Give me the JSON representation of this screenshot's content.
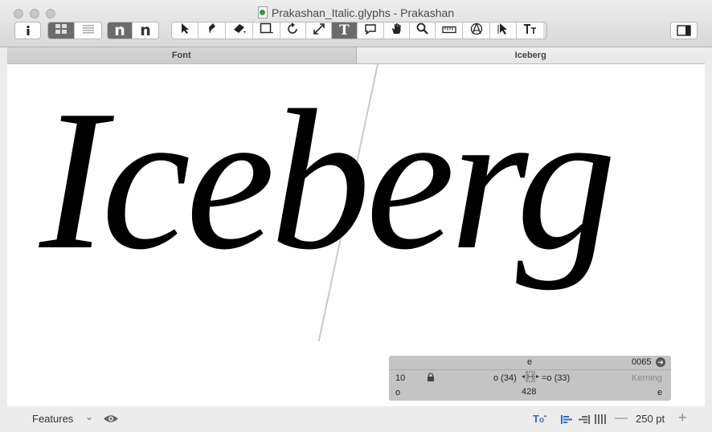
{
  "window": {
    "title": "Prakashan_Italic.glyphs - Prakashan"
  },
  "toolbar": {
    "tools": [
      "info-icon",
      "grid-view-icon",
      "list-view-icon",
      "show-n-icon",
      "show-n-outline-icon",
      "select-icon",
      "pen-icon",
      "eraser-icon",
      "rectangle-icon",
      "rotate-icon",
      "scale-icon",
      "text-icon",
      "annotation-icon",
      "hand-icon",
      "zoom-icon",
      "measure-icon",
      "anchor-icon",
      "select-all-icon",
      "text-scale-icon",
      "sidebar-icon"
    ],
    "active_tool": "text-icon"
  },
  "tabs": [
    {
      "label": "Font",
      "active": true
    },
    {
      "label": "Iceberg",
      "active": false
    }
  ],
  "editor": {
    "text": "Iceberg"
  },
  "glyph_info": {
    "glyph_name": "e",
    "unicode": "0065",
    "lsb": "10",
    "left_group": "o (34)",
    "right_group": "=o (33)",
    "width": "428",
    "kerning_label": "Kerning",
    "left_kern_group": "o",
    "right_kern_group": "e"
  },
  "statusbar": {
    "features_label": "Features",
    "zoom": "250 pt"
  },
  "colors": {
    "accent_blue": "#2a6fc9"
  }
}
